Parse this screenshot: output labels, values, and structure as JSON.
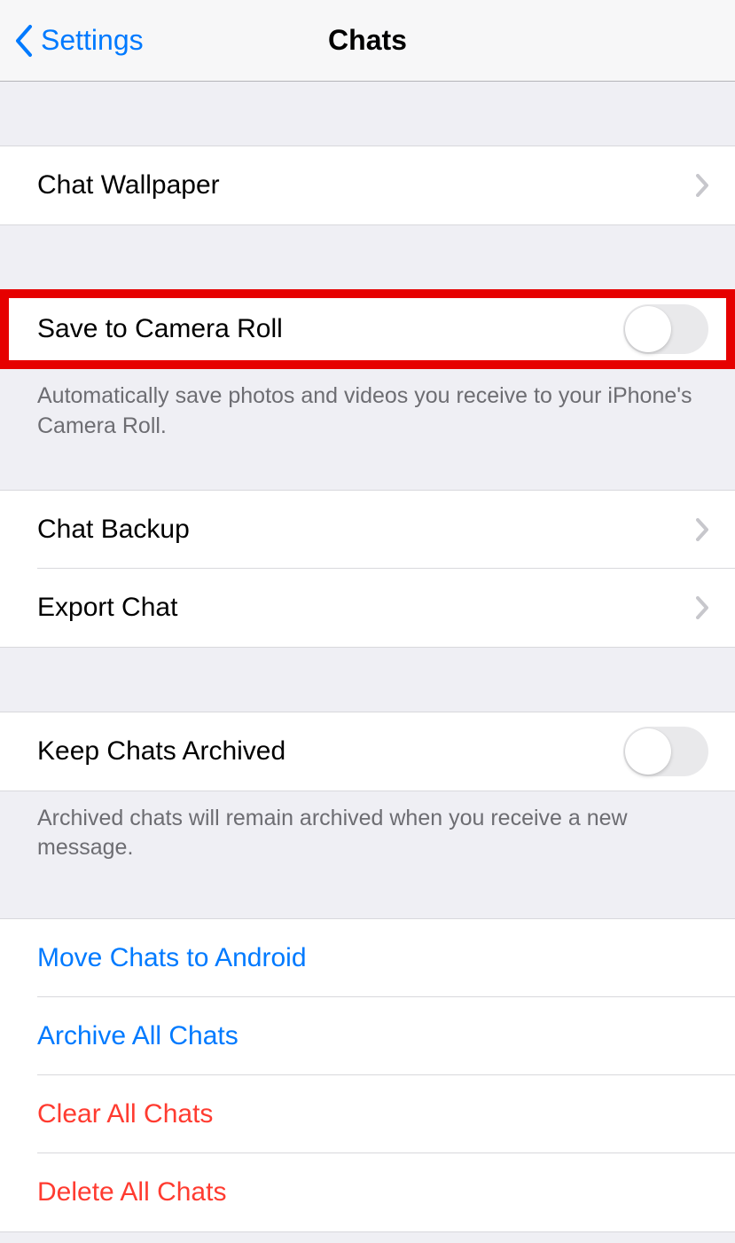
{
  "nav": {
    "back_label": "Settings",
    "title": "Chats"
  },
  "section1": {
    "chat_wallpaper": "Chat Wallpaper"
  },
  "section2": {
    "save_to_camera_roll": "Save to Camera Roll",
    "toggle_on": false,
    "footer": "Automatically save photos and videos you receive to your iPhone's Camera Roll."
  },
  "section3": {
    "chat_backup": "Chat Backup",
    "export_chat": "Export Chat"
  },
  "section4": {
    "keep_archived": "Keep Chats Archived",
    "toggle_on": false,
    "footer": "Archived chats will remain archived when you receive a new message."
  },
  "section5": {
    "move_to_android": "Move Chats to Android",
    "archive_all": "Archive All Chats",
    "clear_all": "Clear All Chats",
    "delete_all": "Delete All Chats"
  }
}
